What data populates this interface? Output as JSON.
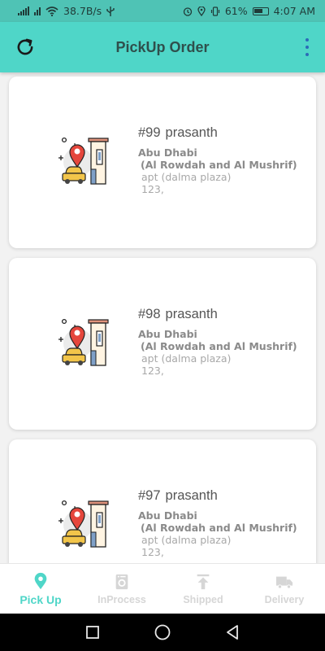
{
  "status_bar": {
    "speed": "38.7B/s",
    "battery": "61%",
    "time": "4:07 AM"
  },
  "header": {
    "title": "PickUp Order",
    "left_icon": "refresh-icon",
    "right_icon": "more-vert-icon"
  },
  "colors": {
    "accent": "#4fd6c8",
    "status_bar": "#4fc3b5",
    "menu_dots": "#2b6bb8",
    "inactive_nav": "#d6d6d6"
  },
  "orders": [
    {
      "number": "#99",
      "name": "prasanth",
      "city": "Abu Dhabi",
      "area": "(Al Rowdah and Al Mushrif)",
      "apt": "apt (dalma plaza)",
      "zip": "123,"
    },
    {
      "number": "#98",
      "name": "prasanth",
      "city": "Abu Dhabi",
      "area": "(Al Rowdah and Al Mushrif)",
      "apt": "apt (dalma plaza)",
      "zip": "123,"
    },
    {
      "number": "#97",
      "name": "prasanth",
      "city": "Abu Dhabi",
      "area": "(Al Rowdah and Al Mushrif)",
      "apt": "apt (dalma plaza)",
      "zip": "123,"
    }
  ],
  "bottom_nav": [
    {
      "label": "Pick Up",
      "icon": "location-pin-icon",
      "active": true
    },
    {
      "label": "InProcess",
      "icon": "washing-machine-icon",
      "active": false
    },
    {
      "label": "Shipped",
      "icon": "upload-icon",
      "active": false
    },
    {
      "label": "Delivery",
      "icon": "truck-icon",
      "active": false
    }
  ]
}
